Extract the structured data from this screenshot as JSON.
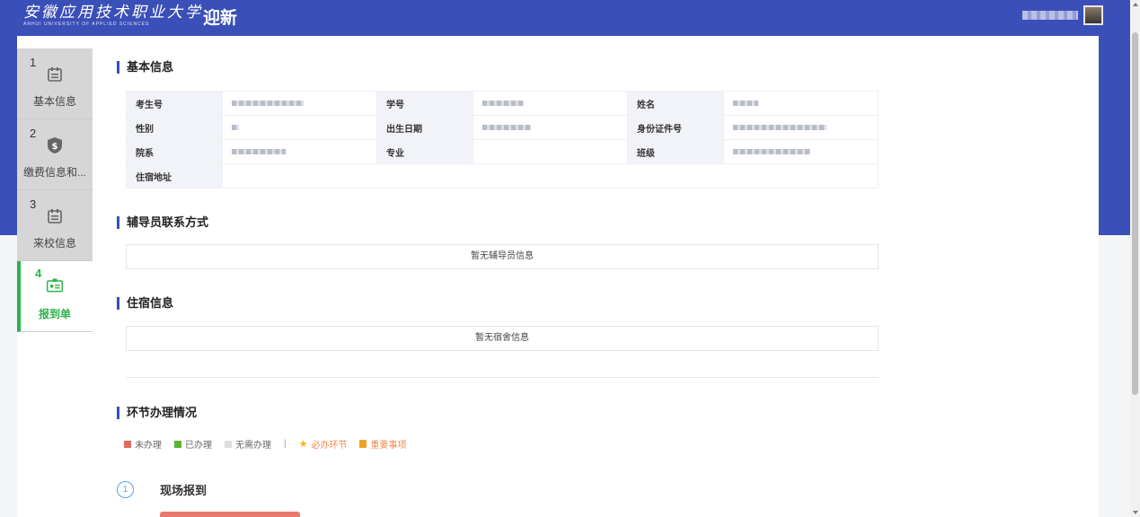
{
  "header": {
    "logo_cn": "安徽应用技术职业大学",
    "logo_en": "ANHUI UNIVERSITY OF APPLIED SCIENCES",
    "app_title": "迎新"
  },
  "steps": [
    {
      "num": "1",
      "label": "基本信息",
      "icon": "document-icon"
    },
    {
      "num": "2",
      "label": "缴费信息和...",
      "icon": "shield-dollar-icon"
    },
    {
      "num": "3",
      "label": "来校信息",
      "icon": "document-icon"
    },
    {
      "num": "4",
      "label": "报到单",
      "icon": "id-card-icon"
    }
  ],
  "basic_info": {
    "title": "基本信息",
    "rows": [
      [
        {
          "k": "考生号",
          "blur": 80
        },
        {
          "k": "学号",
          "blur": 46
        },
        {
          "k": "姓名",
          "blur": 28
        }
      ],
      [
        {
          "k": "性别",
          "blur": 8
        },
        {
          "k": "出生日期",
          "blur": 54
        },
        {
          "k": "身份证件号",
          "blur": 104
        }
      ],
      [
        {
          "k": "院系",
          "blur": 60
        },
        {
          "k": "专业",
          "blur": 0
        },
        {
          "k": "班级",
          "blur": 86
        }
      ]
    ],
    "address_label": "住宿地址"
  },
  "counselor": {
    "title": "辅导员联系方式",
    "empty": "暂无辅导员信息"
  },
  "dorm": {
    "title": "住宿信息",
    "empty": "暂无宿舍信息"
  },
  "progress": {
    "title": "环节办理情况",
    "legend": {
      "not_done": "未办理",
      "done": "已办理",
      "not_needed": "无需办理",
      "sep": "|",
      "required": "必办环节",
      "important": "重要事项"
    },
    "colors": {
      "not_done": "#e06c5e",
      "done": "#5cb531",
      "not_needed": "#dddddd",
      "required": "#f5b800",
      "important": "#f0a020",
      "accent": "#3b4fb8"
    },
    "stage_num": "1",
    "stage_title": "现场报到"
  }
}
